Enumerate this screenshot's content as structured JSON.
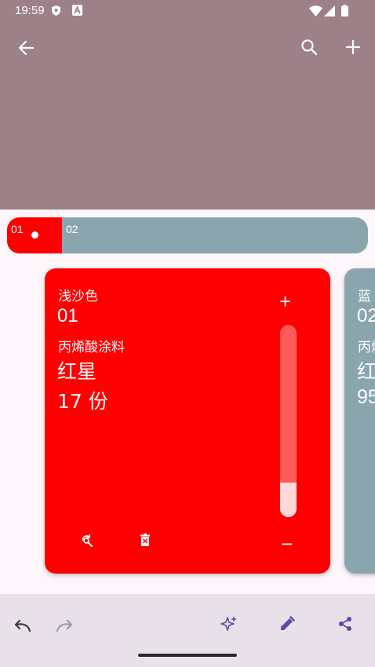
{
  "status_bar": {
    "time": "19:59",
    "icons": [
      "shield-icon",
      "font-a-icon",
      "wifi-icon",
      "signal-icon",
      "battery-icon"
    ]
  },
  "toolbar": {
    "back_icon": "arrow-left-icon",
    "search_icon": "search-icon",
    "add_icon": "plus-icon",
    "background_color": "#9e8088"
  },
  "tabs": [
    {
      "label": "01",
      "color": "#ff0000",
      "selected": true
    },
    {
      "label": "02",
      "color": "#8aa5ae",
      "selected": false
    }
  ],
  "cards": [
    {
      "color_name": "浅沙色",
      "number": "01",
      "paint_type": "丙烯酸涂料",
      "brand": "红星",
      "portion": "17 份",
      "color": "#ff0000",
      "slider_fraction": 0.18,
      "plus_label": "+",
      "minus_label": "−"
    },
    {
      "color_name": "蓝",
      "number": "02",
      "paint_type": "丙烯",
      "brand": "红",
      "portion": "95",
      "color": "#8aa5ae"
    }
  ],
  "bottom_bar": {
    "actions": [
      "undo-icon",
      "redo-icon",
      "sparkle-icon",
      "edit-icon",
      "share-icon"
    ],
    "accent_color": "#5b4ea8"
  }
}
